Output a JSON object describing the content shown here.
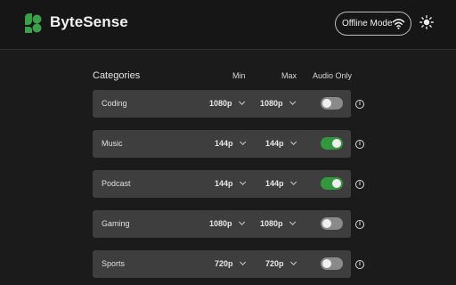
{
  "app": {
    "brand": "ByteSense"
  },
  "header": {
    "offline_label": "Offline Mode"
  },
  "table": {
    "headers": {
      "category": "Categories",
      "min": "Min",
      "max": "Max",
      "audio": "Audio Only"
    },
    "rows": [
      {
        "name": "Coding",
        "min": "1080p",
        "max": "1080p",
        "audio_only": false
      },
      {
        "name": "Music",
        "min": "144p",
        "max": "144p",
        "audio_only": true
      },
      {
        "name": "Podcast",
        "min": "144p",
        "max": "144p",
        "audio_only": true
      },
      {
        "name": "Gaming",
        "min": "1080p",
        "max": "1080p",
        "audio_only": false
      },
      {
        "name": "Sports",
        "min": "720p",
        "max": "720p",
        "audio_only": false
      }
    ]
  },
  "icons": {
    "logo": "bytesense-logo",
    "wifi": "wifi-icon",
    "theme": "sun-icon",
    "info": "info-icon",
    "dropdown": "chevron-down-icon"
  },
  "colors": {
    "accent_green": "#34963e",
    "logo_green": "#3aa14a",
    "background": "#1b1b1b",
    "row_bg": "#3e3e3e"
  }
}
